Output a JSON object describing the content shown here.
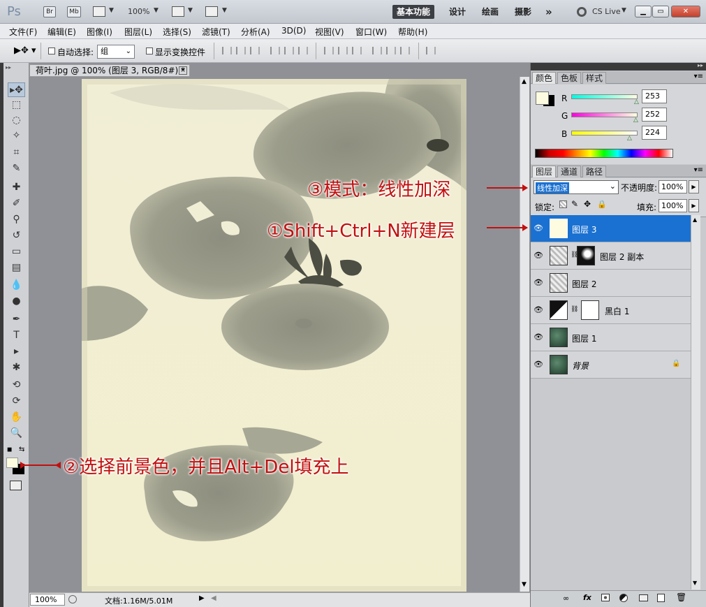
{
  "titlebar": {
    "app_logo": "Ps",
    "chip_br": "Br",
    "chip_mb": "Mb",
    "zoom": "100%",
    "workspaces": [
      "基本功能",
      "设计",
      "绘画",
      "摄影"
    ],
    "more": "»",
    "cs_live": "CS Live"
  },
  "menu": [
    "文件(F)",
    "编辑(E)",
    "图像(I)",
    "图层(L)",
    "选择(S)",
    "滤镜(T)",
    "分析(A)",
    "3D(D)",
    "视图(V)",
    "窗口(W)",
    "帮助(H)"
  ],
  "options": {
    "auto_select_label": "自动选择:",
    "auto_select_value": "组",
    "show_transform_label": "显示变换控件"
  },
  "document": {
    "tab_title": "荷叶.jpg @ 100% (图层 3, RGB/8#) *",
    "close_glyph": "×",
    "status_zoom": "100%",
    "status_doc": "文档:1.16M/5.01M"
  },
  "color_panel": {
    "tabs": [
      "颜色",
      "色板",
      "样式"
    ],
    "r_label": "R",
    "r_value": "253",
    "g_label": "G",
    "g_value": "252",
    "b_label": "B",
    "b_value": "224",
    "fg_color": "#fdfce0",
    "bg_color": "#000000"
  },
  "layers_panel": {
    "tabs": [
      "图层",
      "通道",
      "路径"
    ],
    "blend_mode": "线性加深",
    "opacity_label": "不透明度:",
    "opacity_value": "100%",
    "lock_label": "锁定:",
    "fill_label": "填充:",
    "fill_value": "100%",
    "layers": [
      {
        "name": "图层 3",
        "selected": true
      },
      {
        "name": "图层 2 副本",
        "selected": false
      },
      {
        "name": "图层 2",
        "selected": false
      },
      {
        "name": "黑白 1",
        "selected": false
      },
      {
        "name": "图层 1",
        "selected": false
      },
      {
        "name": "背景",
        "selected": false
      }
    ],
    "bottom_icons": [
      "link-icon",
      "fx-icon",
      "mask-icon",
      "adjustment-icon",
      "group-icon",
      "new-layer-icon",
      "trash-icon"
    ]
  },
  "annotations": {
    "step3": "③模式：线性加深",
    "step1": "①Shift+Ctrl+N新建层",
    "step2": "②选择前景色，并且Alt+Del填充上"
  }
}
